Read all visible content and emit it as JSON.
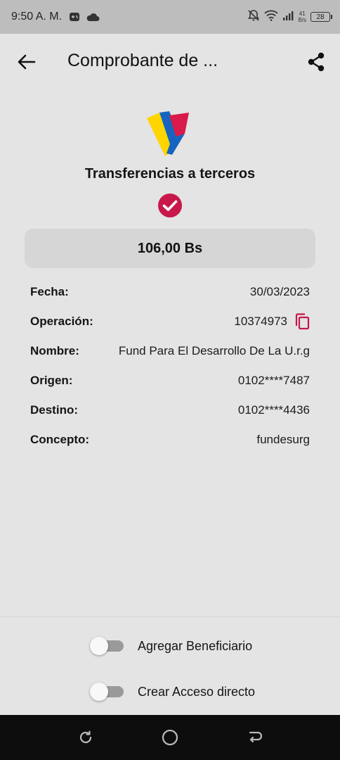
{
  "status_bar": {
    "time": "9:50 A. M.",
    "net_speed_value": "41",
    "net_speed_unit": "B/s",
    "battery": "28",
    "icons": [
      "gamepad-icon",
      "cloud-icon",
      "mute-bell-icon",
      "wifi-icon",
      "signal-icon"
    ]
  },
  "header": {
    "title": "Comprobante de ...",
    "back_icon": "arrow-left-icon",
    "share_icon": "share-icon"
  },
  "receipt": {
    "title": "Transferencias a terceros",
    "amount": "106,00 Bs",
    "details": [
      {
        "label": "Fecha:",
        "value": "30/03/2023"
      },
      {
        "label": "Operación:",
        "value": "10374973"
      },
      {
        "label": "Nombre:",
        "value": "Fund Para El Desarrollo De La U.r.g"
      },
      {
        "label": "Origen:",
        "value": "0102****7487"
      },
      {
        "label": "Destino:",
        "value": "0102****4436"
      },
      {
        "label": "Concepto:",
        "value": "fundesurg"
      }
    ]
  },
  "options": [
    {
      "label": "Agregar Beneficiario",
      "enabled": false
    },
    {
      "label": "Crear Acceso directo",
      "enabled": false
    }
  ],
  "colors": {
    "accent": "#c8184a",
    "background": "#e4e4e4",
    "status_bar": "#bdbdbd",
    "amount_box": "#d6d6d6",
    "logo_yellow": "#ffd500",
    "logo_blue": "#1565c0",
    "logo_red": "#d81b4a"
  }
}
